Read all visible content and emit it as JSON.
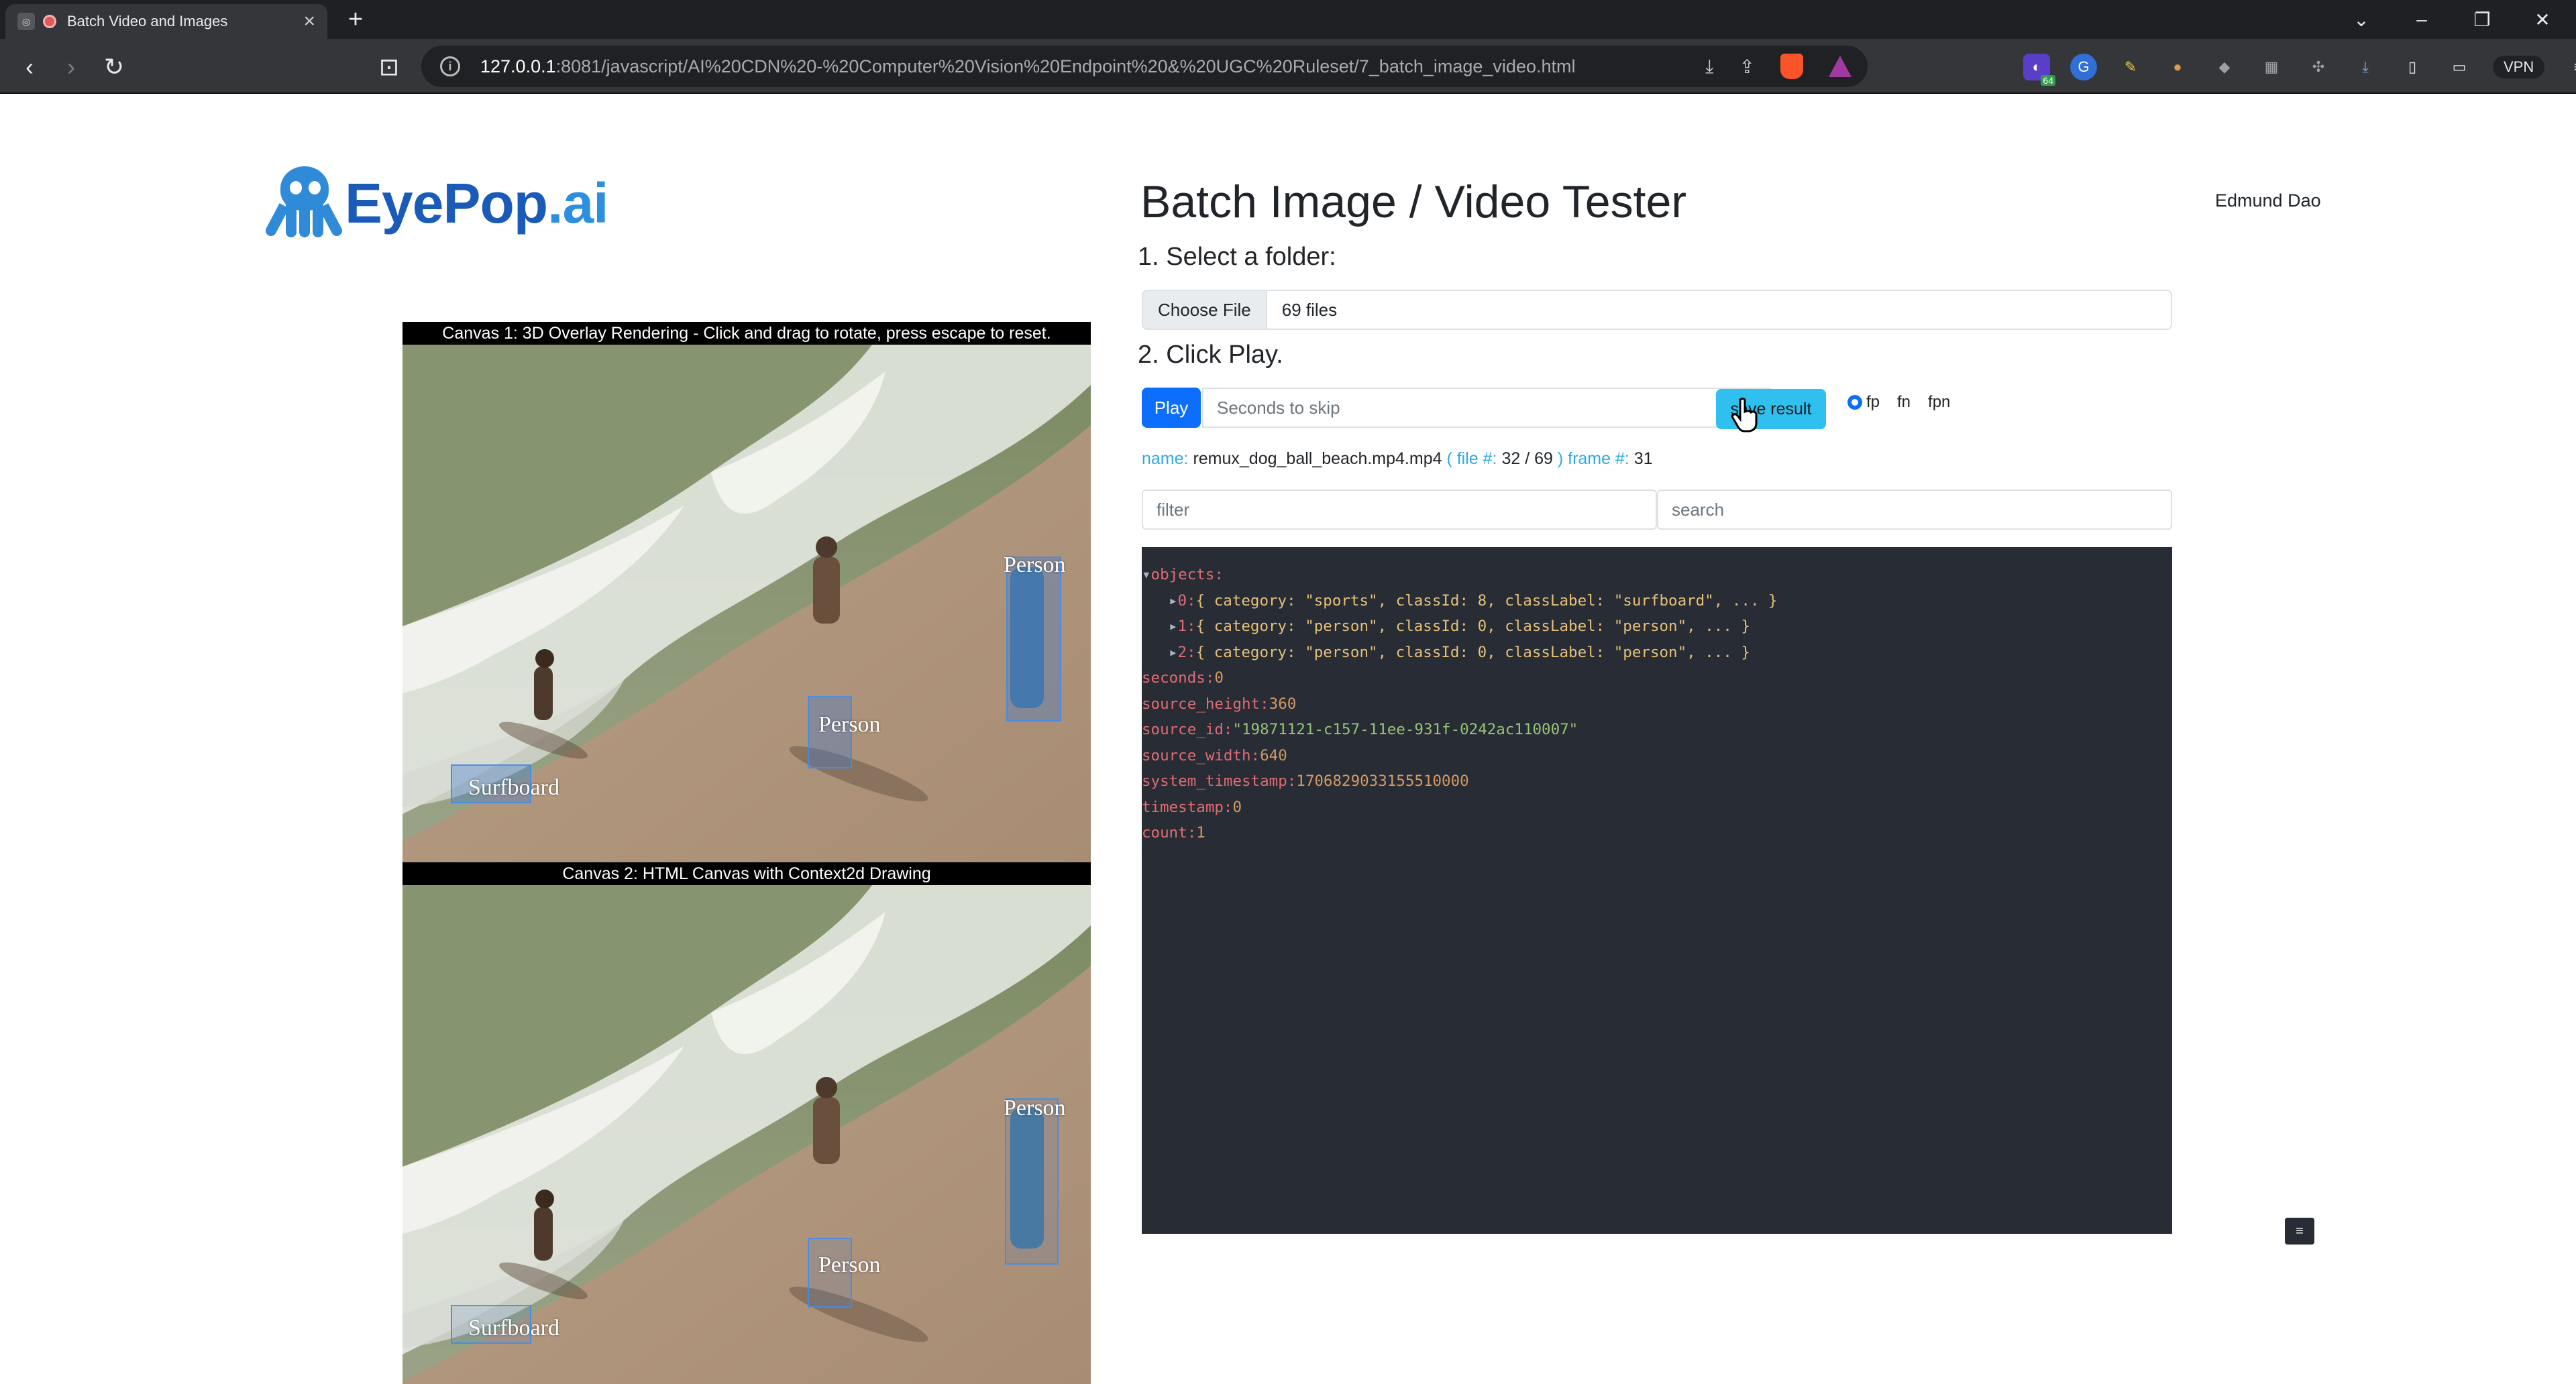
{
  "browser": {
    "tab_title": "Batch Video and Images",
    "url_host": "127.0.0.1",
    "url_rest": ":8081/javascript/AI%20CDN%20-%20Computer%20Vision%20Endpoint%20&%20UGC%20Ruleset/7_batch_image_video.html",
    "ext_badge": "64",
    "vpn_label": "VPN"
  },
  "header": {
    "logo_main": "EyePop",
    "logo_suffix": ".ai",
    "title": "Batch Image / Video Tester",
    "user": "Edmund Dao"
  },
  "step1": {
    "label": "1. Select a folder:",
    "choose_label": "Choose File",
    "file_count": "69 files"
  },
  "step2": {
    "label": "2. Click Play.",
    "play_label": "Play",
    "skip_placeholder": "Seconds to skip",
    "save_label": "save result",
    "radios": [
      "fp",
      "fn",
      "fpn"
    ]
  },
  "status": {
    "name_key": "name:",
    "name_val": "remux_dog_ball_beach.mp4.mp4",
    "file_key": "( file #:",
    "file_val": "32 / 69",
    "frame_key": ") frame #:",
    "frame_val": "31"
  },
  "filters": {
    "filter_placeholder": "filter",
    "search_placeholder": "search"
  },
  "json_view": {
    "objects_key": "objects:",
    "objects": [
      {
        "idx": "0:",
        "preview": "{ category: \"sports\", classId: 8, classLabel: \"surfboard\", ... }"
      },
      {
        "idx": "1:",
        "preview": "{ category: \"person\", classId: 0, classLabel: \"person\", ... }"
      },
      {
        "idx": "2:",
        "preview": "{ category: \"person\", classId: 0, classLabel: \"person\", ... }"
      }
    ],
    "fields": [
      {
        "key": "seconds:",
        "value": "0",
        "kind": "num"
      },
      {
        "key": "source_height:",
        "value": "360",
        "kind": "num"
      },
      {
        "key": "source_id:",
        "value": "\"19871121-c157-11ee-931f-0242ac110007\"",
        "kind": "str"
      },
      {
        "key": "source_width:",
        "value": "640",
        "kind": "num"
      },
      {
        "key": "system_timestamp:",
        "value": "1706829033155510000",
        "kind": "num"
      },
      {
        "key": "timestamp:",
        "value": "0",
        "kind": "num"
      },
      {
        "key": "count:",
        "value": "1",
        "kind": "num"
      }
    ]
  },
  "canvas1": {
    "label": "Canvas 1: 3D Overlay Rendering - Click and drag to rotate, press escape to reset.",
    "detections": [
      "Person",
      "Person",
      "Surfboard"
    ]
  },
  "canvas2": {
    "label": "Canvas 2: HTML Canvas with Context2d Drawing",
    "detections": [
      "Person",
      "Person",
      "Surfboard"
    ]
  },
  "colors": {
    "accent": "#0d6efd",
    "save": "#2fc0f0",
    "json_bg": "#282c34",
    "detection_box": "#4a8ce6"
  }
}
